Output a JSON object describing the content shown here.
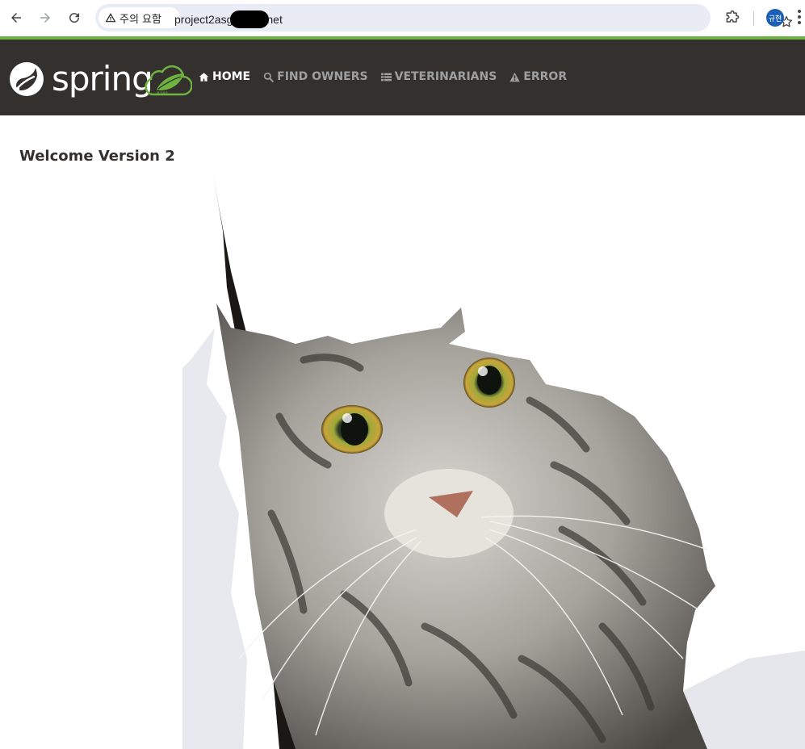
{
  "browser": {
    "security_label": "주의 요함",
    "url_prefix": "project2asg",
    "url_suffix": "net",
    "profile_initials": "규현"
  },
  "navbar": {
    "brand": "spring",
    "items": [
      {
        "label": "HOME",
        "icon": "home-icon",
        "active": true
      },
      {
        "label": "FIND OWNERS",
        "icon": "search-icon",
        "active": false
      },
      {
        "label": "VETERINARIANS",
        "icon": "list-icon",
        "active": false
      },
      {
        "label": "ERROR",
        "icon": "warning-icon",
        "active": false
      }
    ]
  },
  "main": {
    "title": "Welcome Version 2",
    "image": "tabby-cat-tearing-through-paper"
  },
  "colors": {
    "spring_green": "#6db33f",
    "navbar_bg": "#34302d",
    "nav_inactive": "#9f9f9f"
  }
}
